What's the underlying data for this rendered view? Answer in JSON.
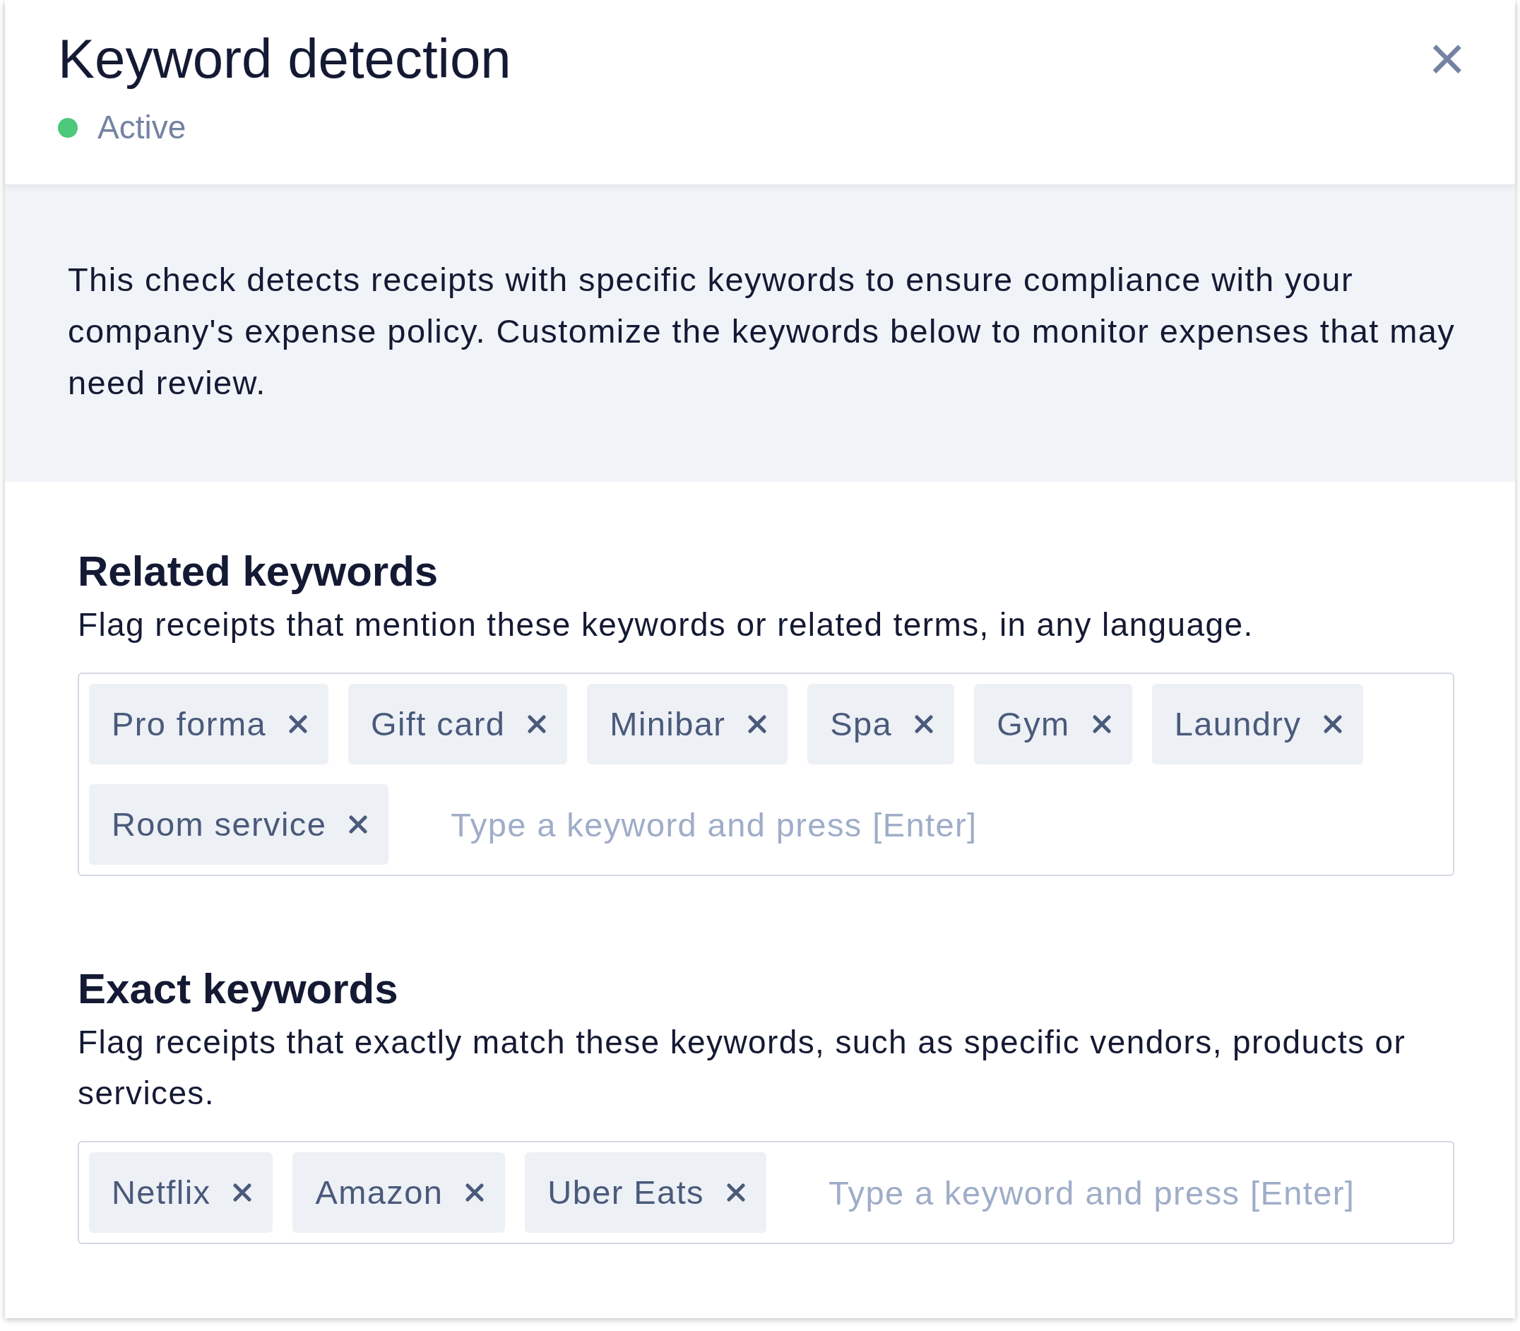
{
  "panel": {
    "title": "Keyword detection",
    "close": "×",
    "status": {
      "label": "Active",
      "active": true
    }
  },
  "description": "This check detects receipts with specific keywords to ensure compliance with your company's expense policy. Customize the keywords below to monitor expenses that may need review.",
  "sections": [
    {
      "heading": "Related keywords",
      "description": "Flag receipts that mention these keywords or related terms, in any language.",
      "keywords": [
        "Pro forma",
        "Gift card",
        "Minibar",
        "Spa",
        "Gym",
        "Laundry",
        "Room service"
      ],
      "placeholder": "Type a keyword and press [Enter]"
    },
    {
      "heading": "Exact keywords",
      "description": "Flag receipts that exactly match these keywords, such as specific vendors, products or services.",
      "keywords": [
        "Netflix",
        "Amazon",
        "Uber Eats"
      ],
      "placeholder": "Type a keyword and press [Enter]"
    }
  ]
}
